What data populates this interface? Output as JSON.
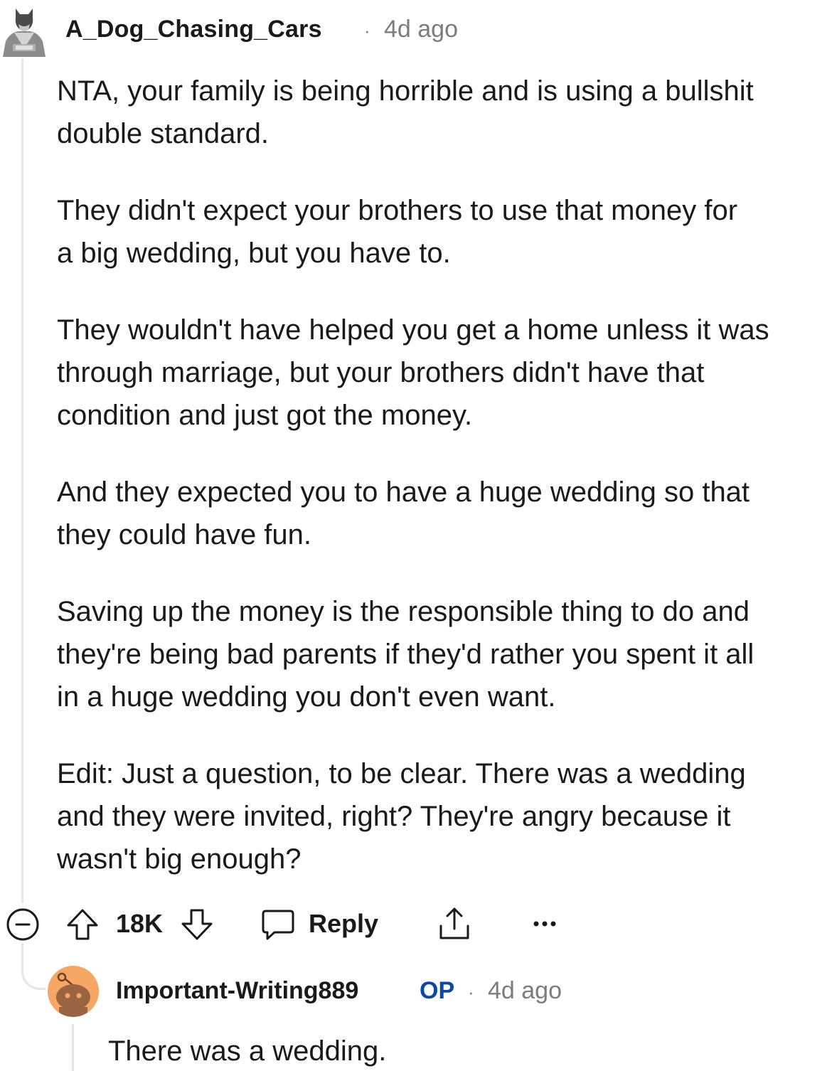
{
  "comment": {
    "author": "A_Dog_Chasing_Cars",
    "separator": "·",
    "time": "4d ago",
    "paragraphs": [
      [
        "NTA, your family is being horrible and is using a bullshit",
        "double standard."
      ],
      [
        "They didn't expect your brothers to use that money for",
        "a big wedding, but you have to."
      ],
      [
        "They wouldn't have helped you get a home unless it was",
        "through marriage, but your brothers didn't have that",
        "condition and just got the money."
      ],
      [
        "And they expected you to have a huge wedding so that",
        "they could have fun."
      ],
      [
        "Saving up the money is the responsible thing to do and",
        "they're being bad parents if they'd rather you spent it all",
        "in a huge wedding you don't even want."
      ],
      [
        "Edit: Just a question, to be clear. There was a wedding",
        "and they were invited, right? They're angry because it",
        "wasn't big enough?"
      ]
    ],
    "actions": {
      "collapse_icon": "collapse-minus-icon",
      "upvote_icon": "upvote-arrow-icon",
      "vote_count": "18K",
      "downvote_icon": "downvote-arrow-icon",
      "reply_icon": "speech-bubble-icon",
      "reply_label": "Reply",
      "share_icon": "share-upload-icon",
      "more_icon": "more-dots-icon",
      "more_label": "···"
    }
  },
  "reply": {
    "author": "Important-Writing889",
    "op_badge": "OP",
    "separator": "·",
    "time": "4d ago",
    "text": "There was a wedding."
  },
  "colors": {
    "text": "#1a1a1b",
    "meta": "#7c7c7c",
    "op_blue": "#0a49a8",
    "thread_line": "#e6e6e6",
    "avatar_orange": "#f6a766",
    "snoo_brown": "#9a6440"
  }
}
